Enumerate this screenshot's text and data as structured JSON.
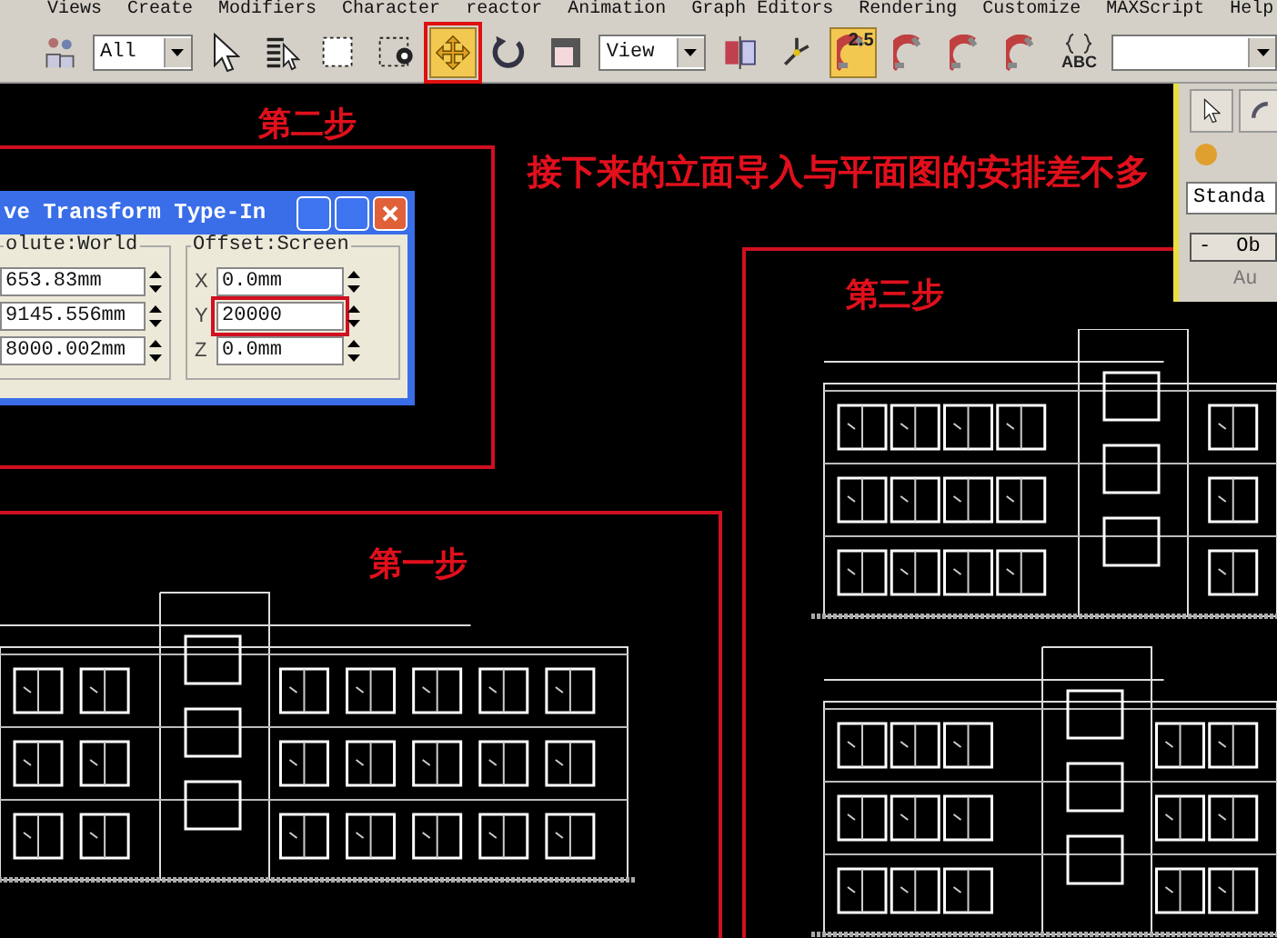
{
  "menu_bar": {
    "items": [
      "Views",
      "Create",
      "Modifiers",
      "Character",
      "reactor",
      "Animation",
      "Graph Editors",
      "Rendering",
      "Customize",
      "MAXScript",
      "Help"
    ]
  },
  "toolbar": {
    "items": [
      {
        "kind": "link-tool",
        "selected": false
      },
      {
        "kind": "dropdown",
        "value": "All"
      },
      {
        "kind": "select",
        "selected": false
      },
      {
        "kind": "select-by-name",
        "selected": false
      },
      {
        "kind": "region",
        "selected": false
      },
      {
        "kind": "window-crossing",
        "selected": false
      },
      {
        "kind": "move",
        "selected": true,
        "marked": true
      },
      {
        "kind": "rotate",
        "selected": false
      },
      {
        "kind": "scale",
        "selected": false
      },
      {
        "kind": "dropdown",
        "value": "View"
      },
      {
        "kind": "pivot",
        "selected": false
      },
      {
        "kind": "axis",
        "selected": false
      },
      {
        "kind": "snap",
        "label": "2.5",
        "selected": true
      },
      {
        "kind": "angle-snap",
        "selected": false
      },
      {
        "kind": "percent-snap",
        "selected": false
      },
      {
        "kind": "spinner-snap",
        "selected": false
      },
      {
        "kind": "named-sets",
        "label": "ABC",
        "selected": false
      },
      {
        "kind": "dropdown",
        "value": ""
      }
    ]
  },
  "annotations": [
    {
      "kind": "step",
      "text": "第二步"
    },
    {
      "kind": "note",
      "text": "接下来的立面导入与平面图的安排差不多"
    },
    {
      "kind": "step",
      "text": "第三步"
    },
    {
      "kind": "step",
      "text": "第一步"
    }
  ],
  "dialog": {
    "title": "ve Transform Type-In",
    "absolute": {
      "title": "olute:World",
      "fields": [
        "653.83mm",
        "9145.556mm",
        "8000.002mm"
      ]
    },
    "offset": {
      "title": "Offset:Screen",
      "fields": [
        {
          "label": "X",
          "value": "0.0mm",
          "marked": false
        },
        {
          "label": "Y",
          "value": "20000",
          "marked": true
        },
        {
          "label": "Z",
          "value": "0.0mm",
          "marked": false
        }
      ]
    }
  },
  "command_panel": {
    "dropdown": "Standa",
    "rollout": {
      "sign": "-",
      "title": "Ob"
    },
    "rollout_text": "Au"
  }
}
